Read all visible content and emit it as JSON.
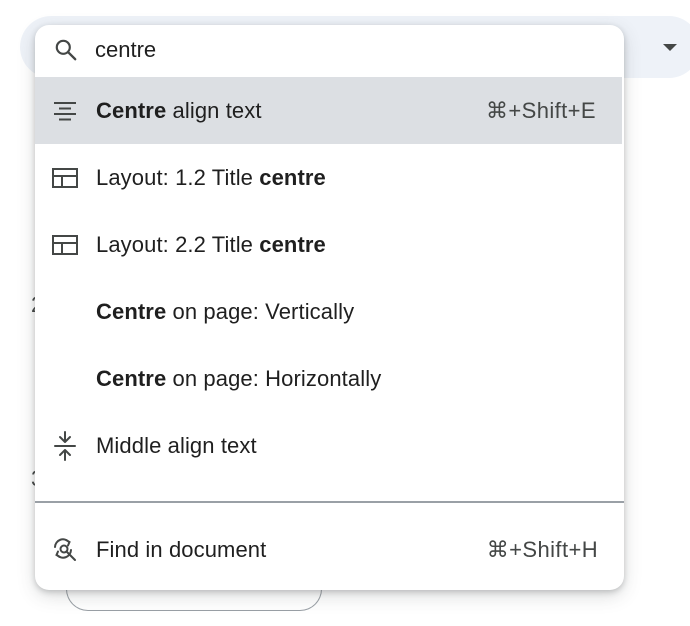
{
  "search": {
    "value": "centre",
    "icon": "search-icon"
  },
  "items": [
    {
      "icon": "align-center-icon",
      "bold": "Centre",
      "rest": " align text",
      "shortcut": "⌘+Shift+E",
      "active": true
    },
    {
      "icon": "layout-icon",
      "prefix": "Layout: 1.2 Title ",
      "bold": "centre"
    },
    {
      "icon": "layout-icon",
      "prefix": "Layout: 2.2 Title ",
      "bold": "centre"
    },
    {
      "icon": "",
      "bold": "Centre",
      "rest": " on page: Vertically"
    },
    {
      "icon": "",
      "bold": "Centre",
      "rest": " on page: Horizontally"
    },
    {
      "icon": "vertical-align-middle-icon",
      "label": "Middle align text"
    }
  ],
  "footer_item": {
    "icon": "find-in-page-icon",
    "label": "Find in document",
    "shortcut": "⌘+Shift+H"
  },
  "colors": {
    "active_row": "#dcdfe3",
    "text": "#1f1f1f",
    "shortcut_text": "#444746",
    "toolbar_bg": "#eef2f8"
  }
}
